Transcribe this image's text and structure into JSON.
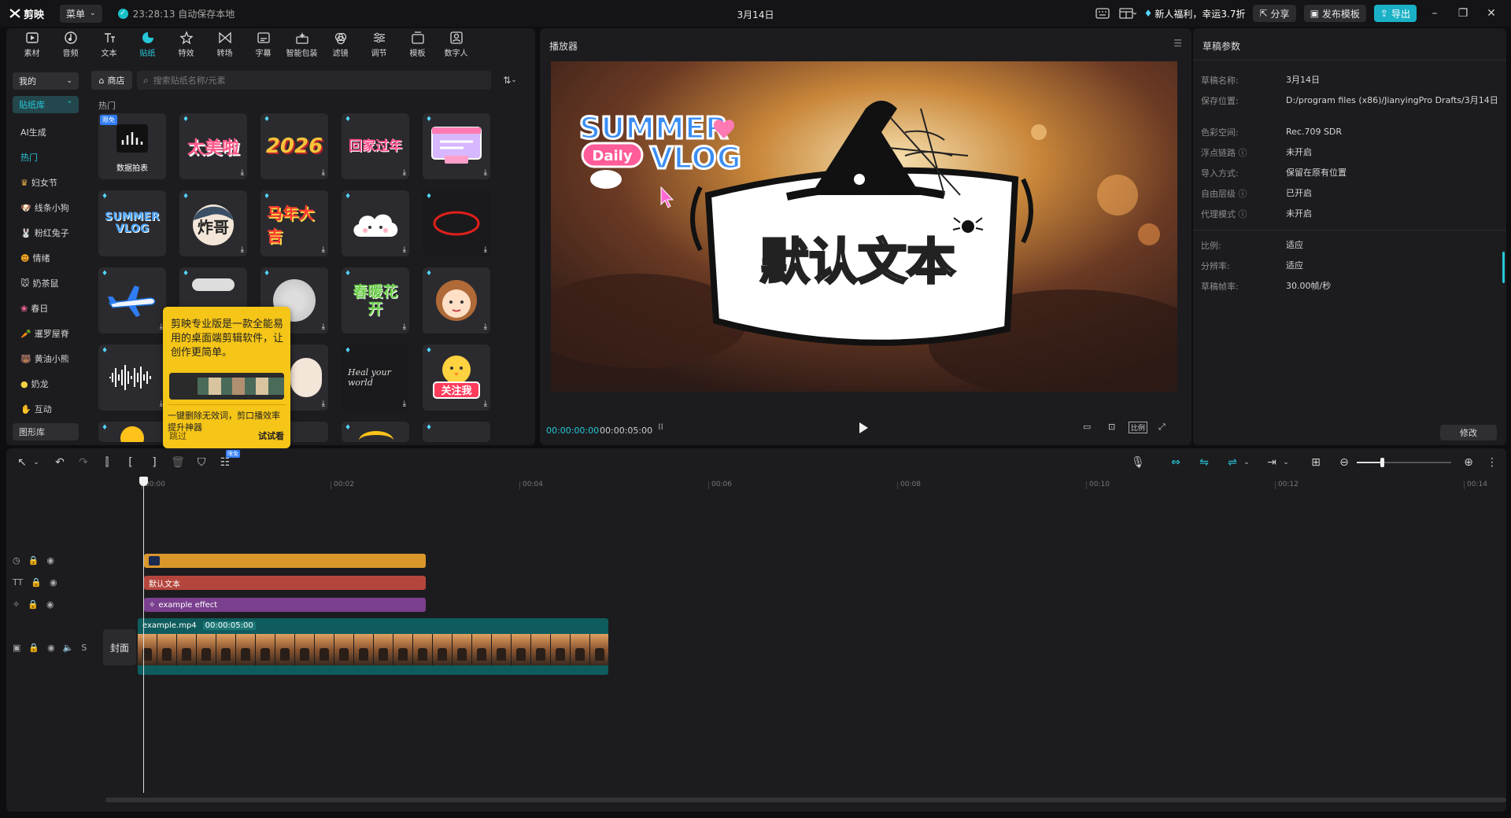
{
  "app": {
    "name": "剪映",
    "menu_label": "菜单",
    "autosave": "23:28:13 自动保存本地",
    "project_title": "3月14日",
    "promo": "新人福利，幸运3.7折",
    "share": "分享",
    "publish_template": "发布模板",
    "export": "导出"
  },
  "toolbar": {
    "items": [
      "素材",
      "音频",
      "文本",
      "贴纸",
      "特效",
      "转场",
      "字幕",
      "智能包装",
      "滤镜",
      "调节",
      "模板",
      "数字人"
    ],
    "active": "贴纸"
  },
  "sidebar": {
    "mine": "我的",
    "library": "贴纸库",
    "items": [
      "AI生成",
      "热门",
      "妇女节",
      "线条小狗",
      "粉红兔子",
      "情绪",
      "奶茶鼠",
      "春日",
      "暹罗屋脊",
      "黄油小熊",
      "奶龙",
      "互动"
    ],
    "bottom": "图形库"
  },
  "stickers": {
    "shop": "商店",
    "search_placeholder": "搜索贴纸名称/元素",
    "section": "热门",
    "limit_badge": "限免",
    "tile0_label": "数据拍表",
    "tiles": [
      "太美啦",
      "2026",
      "回家过年",
      "SUMMER VLOG",
      "炸哥",
      "马年大吉",
      "春暖花开",
      "Heal your world",
      "关注我"
    ]
  },
  "tooltip": {
    "main": "剪映专业版是一款全能易用的桌面端剪辑软件，让创作更简单。",
    "sub": "一键删除无效词，剪口播效率提升神器",
    "skip": "跳过",
    "try": "试试看"
  },
  "player": {
    "title": "播放器",
    "overlay_text": "默认文本",
    "sticker_line1": "SUMMER",
    "sticker_daily": "Daily",
    "sticker_vlog": "VLOG",
    "current_time": "00:00:00:00",
    "total_time": "00:00:05:00",
    "ratio": "比例"
  },
  "draft": {
    "title": "草稿参数",
    "rows": [
      {
        "k": "草稿名称:",
        "v": "3月14日"
      },
      {
        "k": "保存位置:",
        "v": "D:/program files (x86)/JianyingPro Drafts/3月14日"
      },
      {
        "k": "色彩空间:",
        "v": "Rec.709 SDR"
      },
      {
        "k": "浮点链路",
        "v": "未开启"
      },
      {
        "k": "导入方式:",
        "v": "保留在原有位置"
      },
      {
        "k": "自由层级",
        "v": "已开启"
      },
      {
        "k": "代理模式",
        "v": "未开启"
      },
      {
        "k": "比例:",
        "v": "适应"
      },
      {
        "k": "分辨率:",
        "v": "适应"
      },
      {
        "k": "草稿帧率:",
        "v": "30.00帧/秒"
      }
    ],
    "modify": "修改"
  },
  "timeline": {
    "ruler": [
      "00:00",
      "00:02",
      "00:04",
      "00:06",
      "00:08",
      "00:10",
      "00:12",
      "00:14"
    ],
    "text_clip": "默认文本",
    "effect_clip": "example effect",
    "video_clip": "example.mp4",
    "video_duration": "00:00:05:00",
    "cover": "封面",
    "free_badge": "限免",
    "colors": {
      "sticker": "#d9962b",
      "text": "#b4453c",
      "effect": "#7a3f8e",
      "video": "#0e5c5e"
    }
  }
}
